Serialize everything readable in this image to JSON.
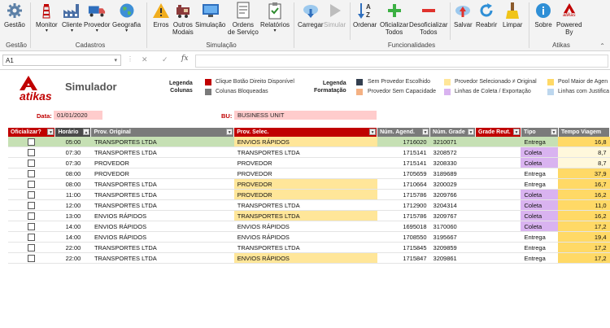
{
  "ribbon": {
    "buttons": [
      {
        "id": "gestao",
        "label": "Gestão",
        "icon": "gear-icon",
        "caret": false,
        "disabled": false
      },
      {
        "id": "monitor",
        "label": "Monitor",
        "icon": "lighthouse-icon",
        "caret": true,
        "disabled": false
      },
      {
        "id": "cliente",
        "label": "Cliente",
        "icon": "factory-icon",
        "caret": true,
        "disabled": false
      },
      {
        "id": "provedor",
        "label": "Provedor",
        "icon": "truck-icon",
        "caret": true,
        "disabled": false
      },
      {
        "id": "geografia",
        "label": "Geografia",
        "icon": "globe-icon",
        "caret": true,
        "disabled": false
      },
      {
        "id": "erros",
        "label": "Erros",
        "icon": "warning-icon",
        "caret": false,
        "disabled": false
      },
      {
        "id": "outros_modais",
        "label": "Outros\nModais",
        "icon": "train-icon",
        "caret": false,
        "disabled": false
      },
      {
        "id": "simulacao",
        "label": "Simulação",
        "icon": "monitor-icon",
        "caret": false,
        "disabled": false
      },
      {
        "id": "ordens",
        "label": "Ordens\nde Serviço",
        "icon": "document-icon",
        "caret": false,
        "disabled": false
      },
      {
        "id": "relatorios",
        "label": "Relatórios",
        "icon": "clipboard-icon",
        "caret": true,
        "disabled": false
      },
      {
        "id": "carregar",
        "label": "Carregar",
        "icon": "cloud-download-icon",
        "caret": false,
        "disabled": false
      },
      {
        "id": "simular",
        "label": "Simular",
        "icon": "play-icon",
        "caret": false,
        "disabled": true
      },
      {
        "id": "ordenar",
        "label": "Ordenar",
        "icon": "sort-az-icon",
        "caret": false,
        "disabled": false
      },
      {
        "id": "oficializar",
        "label": "Oficializar\nTodos",
        "icon": "plus-icon",
        "caret": false,
        "disabled": false
      },
      {
        "id": "desoficializar",
        "label": "Desoficializar\nTodos",
        "icon": "minus-icon",
        "caret": false,
        "disabled": false
      },
      {
        "id": "salvar",
        "label": "Salvar",
        "icon": "cloud-upload-icon",
        "caret": false,
        "disabled": false
      },
      {
        "id": "reabrir",
        "label": "Reabrir",
        "icon": "refresh-icon",
        "caret": false,
        "disabled": false
      },
      {
        "id": "limpar",
        "label": "Limpar",
        "icon": "brush-icon",
        "caret": false,
        "disabled": false
      },
      {
        "id": "sobre",
        "label": "Sobre",
        "icon": "info-icon",
        "caret": false,
        "disabled": false
      },
      {
        "id": "powered",
        "label": "Powered\nBy",
        "icon": "atikas-logo-icon",
        "caret": false,
        "disabled": false
      }
    ],
    "groups": [
      "Gestão",
      "Cadastros",
      "Simulação",
      "Funcionalidades",
      "Atikas"
    ]
  },
  "formula_bar": {
    "cell_ref": "A1",
    "value": ""
  },
  "sheet": {
    "brand": "atikas",
    "powered_brand": "atikas",
    "title": "Simulador",
    "legend_colunas_head": "Legenda\nColunas",
    "legend_formatacao_head": "Legenda\nFormatação",
    "legend_colunas": [
      {
        "color": "#c00000",
        "label": "Clique Botão Direito Disponível"
      },
      {
        "color": "#7a7a7a",
        "label": "Colunas Bloqueadas"
      }
    ],
    "legend_formatacao": [
      {
        "color": "#333f4f",
        "label": "Sem Provedor Escolhido"
      },
      {
        "color": "#f4b183",
        "label": "Provedor Sem Capacidade"
      },
      {
        "color": "#ffe699",
        "label": "Provedor Selecionado ≠ Original"
      },
      {
        "color": "#d9b3f0",
        "label": "Linhas de Coleta / Exportação"
      },
      {
        "color": "#ffd966",
        "label": "Pool Maior de Agen"
      },
      {
        "color": "#bdd7ee",
        "label": "Linhas com Justifica"
      }
    ],
    "data_label": "Data:",
    "data_value": "01/01/2020",
    "bu_label": "BU:",
    "bu_value": "BUSINESS UNIT"
  },
  "table": {
    "headers": [
      "Oficializar?",
      "Horário",
      "Prov. Original",
      "Prov. Selec.",
      "Núm. Agend.",
      "Núm. Grade",
      "Grade Reut.",
      "Tipo",
      "Tempo Viagem"
    ],
    "rows": [
      {
        "time": "05:00",
        "orig": "TRANSPORTES LTDA",
        "sel": "ENVIOS RÁPIDOS",
        "agend": "1716020",
        "grade": "3210071",
        "reut": "",
        "tipo": "Entrega",
        "tv": "16,8",
        "sel_diff": true,
        "coleta": false,
        "tv_high": true,
        "selected": true
      },
      {
        "time": "07:30",
        "orig": "TRANSPORTES LTDA",
        "sel": "TRANSPORTES LTDA",
        "agend": "1715141",
        "grade": "3208572",
        "reut": "",
        "tipo": "Coleta",
        "tv": "8,7",
        "sel_diff": false,
        "coleta": true,
        "tv_high": false,
        "selected": false
      },
      {
        "time": "07:30",
        "orig": "PROVEDOR",
        "sel": "PROVEDOR",
        "agend": "1715141",
        "grade": "3208330",
        "reut": "",
        "tipo": "Coleta",
        "tv": "8,7",
        "sel_diff": false,
        "coleta": true,
        "tv_high": false,
        "selected": false
      },
      {
        "time": "08:00",
        "orig": "PROVEDOR",
        "sel": "PROVEDOR",
        "agend": "1705659",
        "grade": "3189689",
        "reut": "",
        "tipo": "Entrega",
        "tv": "37,9",
        "sel_diff": false,
        "coleta": false,
        "tv_high": true,
        "selected": false
      },
      {
        "time": "08:00",
        "orig": "TRANSPORTES LTDA",
        "sel": "PROVEDOR",
        "agend": "1710664",
        "grade": "3200029",
        "reut": "",
        "tipo": "Entrega",
        "tv": "16,7",
        "sel_diff": true,
        "coleta": false,
        "tv_high": true,
        "selected": false
      },
      {
        "time": "11:00",
        "orig": "TRANSPORTES LTDA",
        "sel": "PROVEDOR",
        "agend": "1715786",
        "grade": "3209766",
        "reut": "",
        "tipo": "Coleta",
        "tv": "16,2",
        "sel_diff": true,
        "coleta": true,
        "tv_high": true,
        "selected": false
      },
      {
        "time": "12:00",
        "orig": "TRANSPORTES LTDA",
        "sel": "TRANSPORTES LTDA",
        "agend": "1712900",
        "grade": "3204314",
        "reut": "",
        "tipo": "Coleta",
        "tv": "11,0",
        "sel_diff": false,
        "coleta": true,
        "tv_high": true,
        "selected": false
      },
      {
        "time": "13:00",
        "orig": "ENVIOS RÁPIDOS",
        "sel": "TRANSPORTES LTDA",
        "agend": "1715786",
        "grade": "3209767",
        "reut": "",
        "tipo": "Coleta",
        "tv": "16,2",
        "sel_diff": true,
        "coleta": true,
        "tv_high": true,
        "selected": false
      },
      {
        "time": "14:00",
        "orig": "ENVIOS RÁPIDOS",
        "sel": "ENVIOS RÁPIDOS",
        "agend": "1695018",
        "grade": "3170060",
        "reut": "",
        "tipo": "Coleta",
        "tv": "17,2",
        "sel_diff": false,
        "coleta": true,
        "tv_high": true,
        "selected": false
      },
      {
        "time": "14:00",
        "orig": "ENVIOS RÁPIDOS",
        "sel": "ENVIOS RÁPIDOS",
        "agend": "1708550",
        "grade": "3195667",
        "reut": "",
        "tipo": "Entrega",
        "tv": "19,4",
        "sel_diff": false,
        "coleta": false,
        "tv_high": true,
        "selected": false
      },
      {
        "time": "22:00",
        "orig": "TRANSPORTES LTDA",
        "sel": "TRANSPORTES LTDA",
        "agend": "1715845",
        "grade": "3209859",
        "reut": "",
        "tipo": "Entrega",
        "tv": "17,2",
        "sel_diff": false,
        "coleta": false,
        "tv_high": true,
        "selected": false
      },
      {
        "time": "22:00",
        "orig": "TRANSPORTES LTDA",
        "sel": "ENVIOS RÁPIDOS",
        "agend": "1715847",
        "grade": "3209861",
        "reut": "",
        "tipo": "Entrega",
        "tv": "17,2",
        "sel_diff": true,
        "coleta": false,
        "tv_high": true,
        "selected": false
      }
    ]
  },
  "colors": {
    "accent_red": "#c00000",
    "selected_row": "#c6e0b4",
    "coleta": "#d9b3f0",
    "gold": "#ffe699",
    "tempo": "#ffd966"
  }
}
